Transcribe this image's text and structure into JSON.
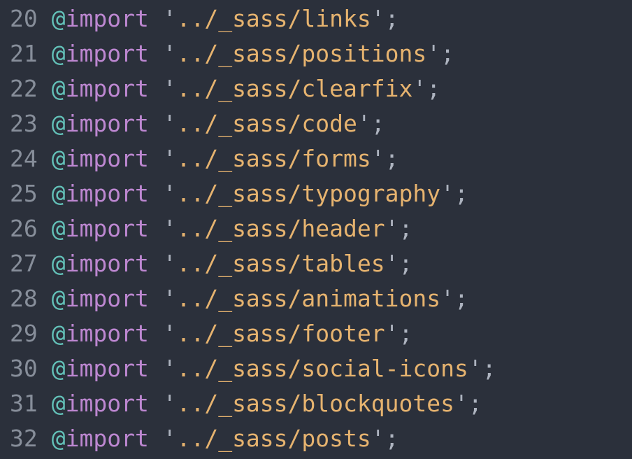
{
  "colors": {
    "background": "#2b303b",
    "gutter": "#878e9a",
    "at": "#63c1b8",
    "keyword": "#bd87d1",
    "string": "#e6b36f",
    "punct": "#adb3bf"
  },
  "keyword": "import",
  "lines": [
    {
      "no": "20",
      "path": "../_sass/links"
    },
    {
      "no": "21",
      "path": "../_sass/positions"
    },
    {
      "no": "22",
      "path": "../_sass/clearfix"
    },
    {
      "no": "23",
      "path": "../_sass/code"
    },
    {
      "no": "24",
      "path": "../_sass/forms"
    },
    {
      "no": "25",
      "path": "../_sass/typography"
    },
    {
      "no": "26",
      "path": "../_sass/header"
    },
    {
      "no": "27",
      "path": "../_sass/tables"
    },
    {
      "no": "28",
      "path": "../_sass/animations"
    },
    {
      "no": "29",
      "path": "../_sass/footer"
    },
    {
      "no": "30",
      "path": "../_sass/social-icons"
    },
    {
      "no": "31",
      "path": "../_sass/blockquotes"
    },
    {
      "no": "32",
      "path": "../_sass/posts"
    }
  ],
  "glyphs": {
    "at": "@",
    "space": " ",
    "quote": "'",
    "semicolon": ";"
  }
}
